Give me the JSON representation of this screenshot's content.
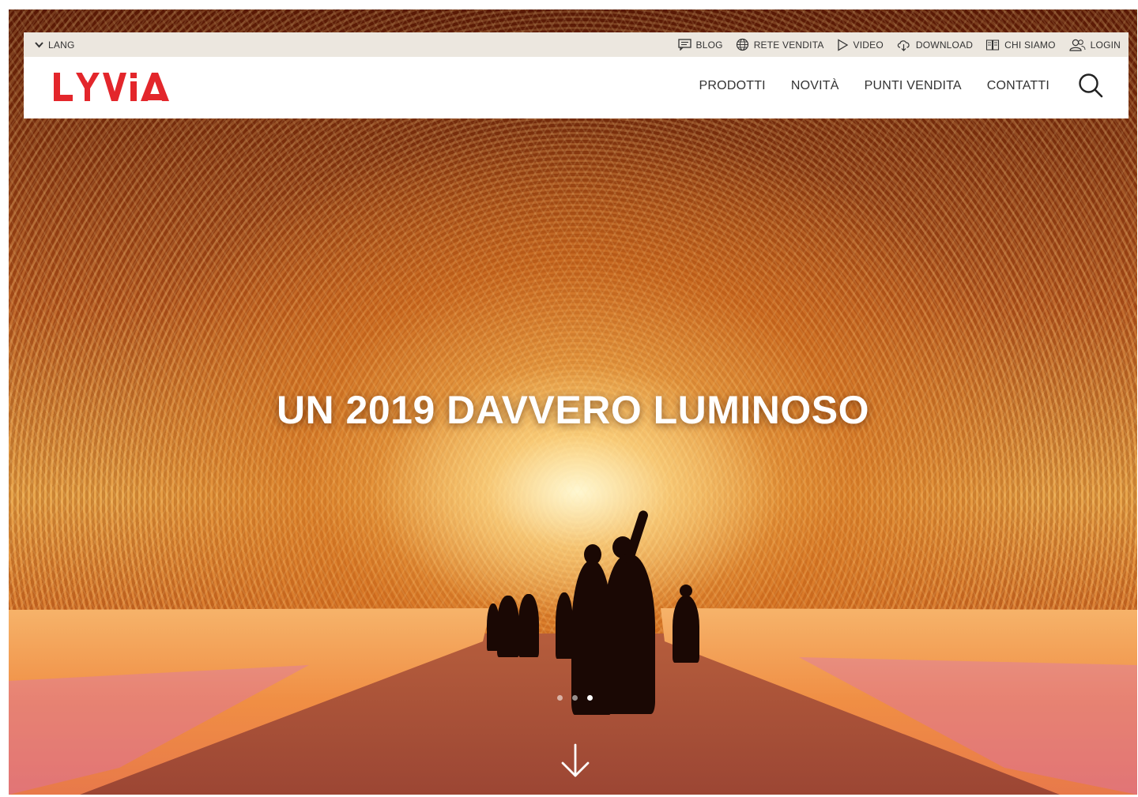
{
  "topbar": {
    "lang_label": "LANG",
    "links": [
      {
        "label": "BLOG",
        "icon": "chat-icon"
      },
      {
        "label": "RETE VENDITA",
        "icon": "globe-icon"
      },
      {
        "label": "VIDEO",
        "icon": "play-icon"
      },
      {
        "label": "DOWNLOAD",
        "icon": "cloud-download-icon"
      },
      {
        "label": "CHI SIAMO",
        "icon": "book-icon"
      },
      {
        "label": "LOGIN",
        "icon": "user-icon"
      }
    ]
  },
  "brand": {
    "name": "LYVIA",
    "color": "#e3262b"
  },
  "nav": {
    "items": [
      "PRODOTTI",
      "NOVITÀ",
      "PUNTI VENDITA",
      "CONTATTI"
    ],
    "search_icon": "search-icon"
  },
  "hero": {
    "headline": "UN 2019 DAVVERO LUMINOSO",
    "slides_count": 3,
    "active_slide": 3,
    "scroll_icon": "arrow-down-icon"
  }
}
